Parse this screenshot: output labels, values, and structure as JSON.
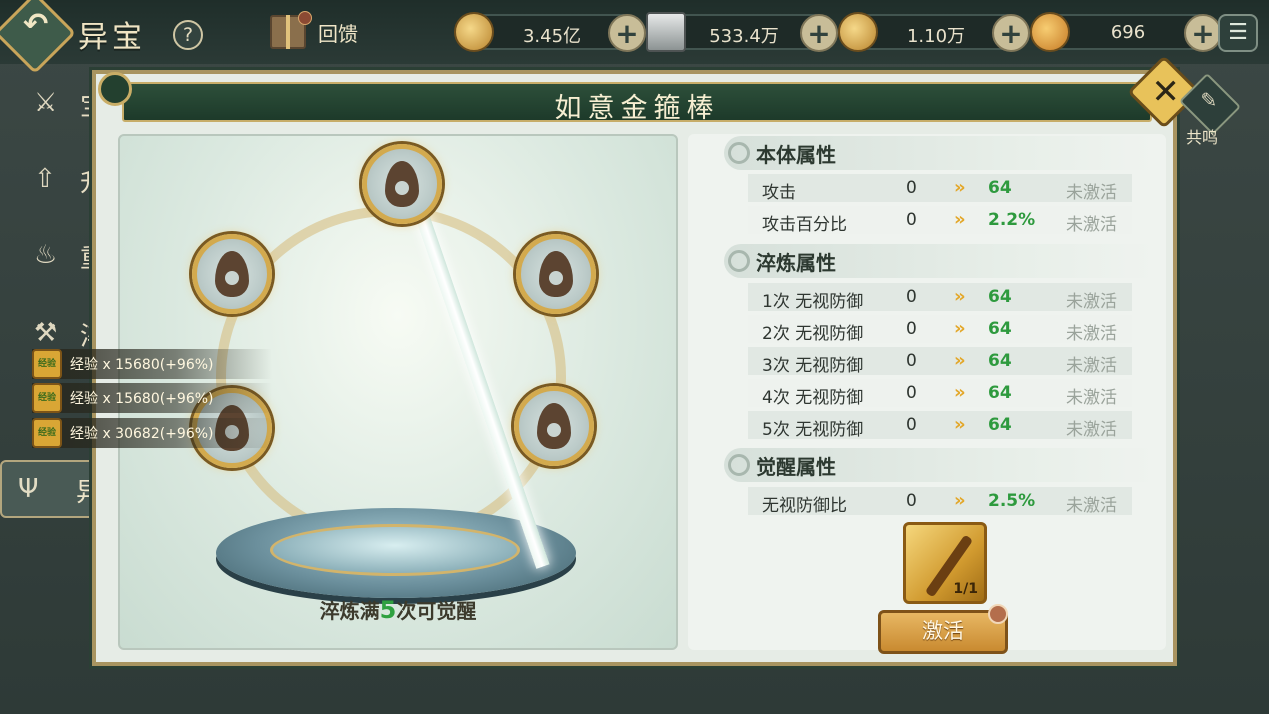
{
  "topbar": {
    "back_icon": "back-arrow-icon",
    "title": "异宝",
    "help_label": "?",
    "feedback_label": "回馈",
    "currencies": [
      {
        "icon": "copper-coin-icon",
        "value": "3.45亿",
        "plus": "+"
      },
      {
        "icon": "silver-ingot-icon",
        "value": "533.4万",
        "plus": "+"
      },
      {
        "icon": "gold-ingot-icon",
        "value": "1.10万",
        "plus": "+"
      },
      {
        "icon": "yuanbao-icon",
        "value": "696",
        "plus": "+"
      }
    ],
    "menu_glyph": "☰"
  },
  "side_tabs": [
    {
      "icon": "crossed-swords-icon",
      "glyph": "⚔",
      "label": "宝"
    },
    {
      "icon": "upgrade-arrow-icon",
      "glyph": "⇧",
      "label": "升"
    },
    {
      "icon": "flame-icon",
      "glyph": "♨",
      "label": "重"
    },
    {
      "icon": "anvil-icon",
      "glyph": "⚒",
      "label": "淬"
    },
    {
      "icon": "trident-icon",
      "glyph": "Ψ",
      "label": "异"
    }
  ],
  "exp_popups": [
    {
      "icon_label": "经验",
      "text": "经验 x 15680(+96%)"
    },
    {
      "icon_label": "经验",
      "text": "经验 x 15680(+96%)"
    },
    {
      "icon_label": "经验",
      "text": "经验 x 30682(+96%)"
    }
  ],
  "modal": {
    "title": "如意金箍棒",
    "close_glyph": "✕",
    "resonance_label": "共鸣",
    "resonance_glyph": "✎",
    "refine_note": {
      "before": "淬炼满",
      "num": "5",
      "after": "次可觉醒"
    },
    "sections": [
      {
        "title": "本体属性",
        "rows": [
          {
            "name": "攻击",
            "current": "0",
            "next": "64",
            "state": "未激活"
          },
          {
            "name": "攻击百分比",
            "current": "0",
            "next": "2.2%",
            "state": "未激活"
          }
        ]
      },
      {
        "title": "淬炼属性",
        "rows": [
          {
            "name": "1次  无视防御",
            "current": "0",
            "next": "64",
            "state": "未激活"
          },
          {
            "name": "2次  无视防御",
            "current": "0",
            "next": "64",
            "state": "未激活"
          },
          {
            "name": "3次  无视防御",
            "current": "0",
            "next": "64",
            "state": "未激活"
          },
          {
            "name": "4次  无视防御",
            "current": "0",
            "next": "64",
            "state": "未激活"
          },
          {
            "name": "5次  无视防御",
            "current": "0",
            "next": "64",
            "state": "未激活"
          }
        ]
      },
      {
        "title": "觉醒属性",
        "rows": [
          {
            "name": "无视防御比",
            "current": "0",
            "next": "2.5%",
            "state": "未激活"
          }
        ]
      }
    ],
    "arrow_glyph": "»",
    "item_count": "1/1",
    "activate_label": "激活"
  },
  "colors": {
    "accent_gold": "#c9ad66",
    "header_green": "#1d3a2a",
    "value_green": "#2e9a3e",
    "inactive_gray": "#9aa39b"
  }
}
